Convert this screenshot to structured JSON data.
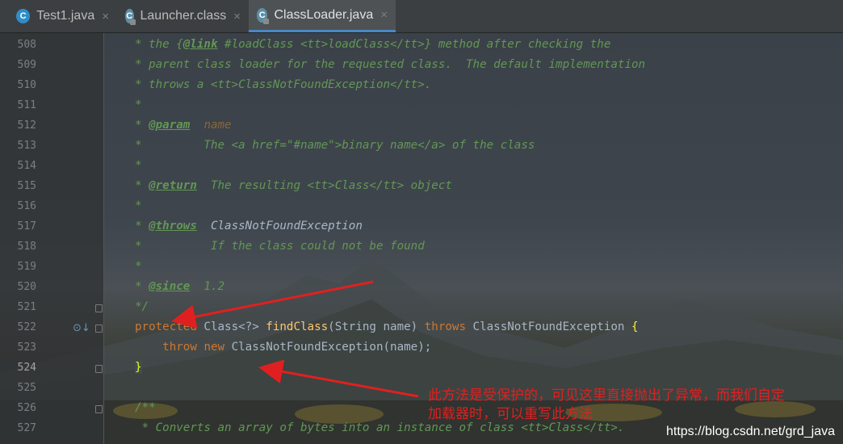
{
  "tabs": [
    {
      "label": "Test1.java",
      "icon": "java-class-icon",
      "active": false
    },
    {
      "label": "Launcher.class",
      "icon": "compiled-class-icon",
      "active": false
    },
    {
      "label": "ClassLoader.java",
      "icon": "compiled-class-icon",
      "active": true
    }
  ],
  "close_glyph": "×",
  "lines": {
    "508": {
      "num": "508",
      "a": "* the {",
      "b": "@link",
      "c": " #loadClass <tt>loadClass</tt>} method after checking the"
    },
    "509": {
      "num": "509",
      "a": "* parent class loader for the requested class.  The default implementation"
    },
    "510": {
      "num": "510",
      "a": "* throws a <tt>ClassNotFoundException</tt>."
    },
    "511": {
      "num": "511",
      "a": "*"
    },
    "512": {
      "num": "512",
      "a": "* ",
      "b": "@param",
      "c": "  ",
      "d": "name"
    },
    "513": {
      "num": "513",
      "a": "*         The <a href=\"#name\">binary name</a> of the class"
    },
    "514": {
      "num": "514",
      "a": "*"
    },
    "515": {
      "num": "515",
      "a": "* ",
      "b": "@return",
      "c": "  The resulting <tt>Class</tt> object"
    },
    "516": {
      "num": "516",
      "a": "*"
    },
    "517": {
      "num": "517",
      "a": "* ",
      "b": "@throws",
      "c": "  ClassNotFoundException"
    },
    "518": {
      "num": "518",
      "a": "*          If the class could not be found"
    },
    "519": {
      "num": "519",
      "a": "*"
    },
    "520": {
      "num": "520",
      "a": "* ",
      "b": "@since",
      "c": "  1.2"
    },
    "521": {
      "num": "521",
      "a": "*/"
    },
    "522": {
      "num": "522",
      "kw1": "protected",
      "t1": " Class<?> ",
      "fn": "findClass",
      "t2": "(String name) ",
      "kw2": "throws",
      "t3": " ClassNotFoundException ",
      "brace": "{"
    },
    "523": {
      "num": "523",
      "indent": "    ",
      "kw1": "throw",
      "sp": " ",
      "kw2": "new",
      "t1": " ClassNotFoundException(name);"
    },
    "524": {
      "num": "524",
      "brace": "}"
    },
    "525": {
      "num": "525"
    },
    "526": {
      "num": "526",
      "a": "/**"
    },
    "527": {
      "num": "527",
      "a": " * Converts an array of bytes into an instance of class <tt>Class</tt>."
    }
  },
  "annotation": {
    "line1": "此方法是受保护的，可见这里直接抛出了异常，而我们自定",
    "line2": "加载器时，可以重写此方法",
    "color": "#e02020"
  },
  "watermark": "https://blog.csdn.net/grd_java",
  "colors": {
    "keyword": "#cc7832",
    "method": "#ffc66d",
    "javadoc": "#629755",
    "text": "#a9b7c6",
    "accent": "#4a88c7"
  }
}
